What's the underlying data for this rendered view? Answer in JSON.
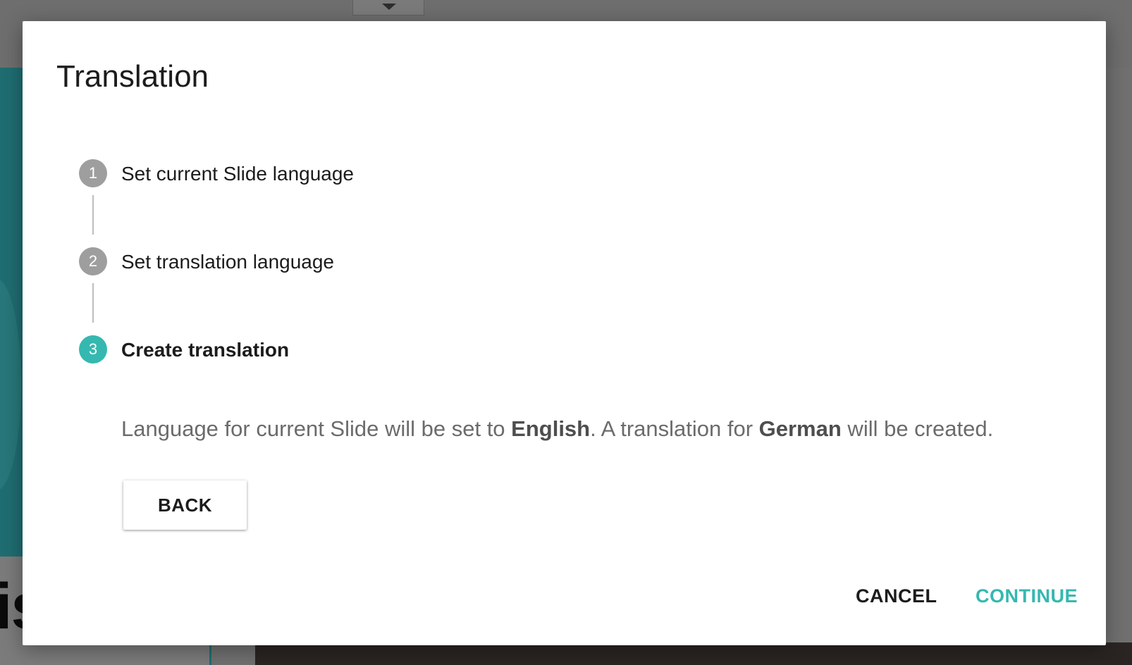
{
  "dialog": {
    "title": "Translation"
  },
  "stepper": {
    "steps": [
      {
        "number": "1",
        "label": "Set current Slide language",
        "state": "completed"
      },
      {
        "number": "2",
        "label": "Set translation language",
        "state": "completed"
      },
      {
        "number": "3",
        "label": "Create translation",
        "state": "active"
      }
    ]
  },
  "step_content": {
    "message_prefix": "Language for current Slide will be set to ",
    "source_language": "English",
    "message_middle": ". A translation for ",
    "target_language": "German",
    "message_suffix": " will be created.",
    "back_label": "BACK"
  },
  "actions": {
    "cancel_label": "CANCEL",
    "continue_label": "CONTINUE"
  },
  "background": {
    "partial_text": "is"
  },
  "colors": {
    "accent": "#35b8b0",
    "inactive_step": "#9e9e9e",
    "overlay": "#707070"
  }
}
